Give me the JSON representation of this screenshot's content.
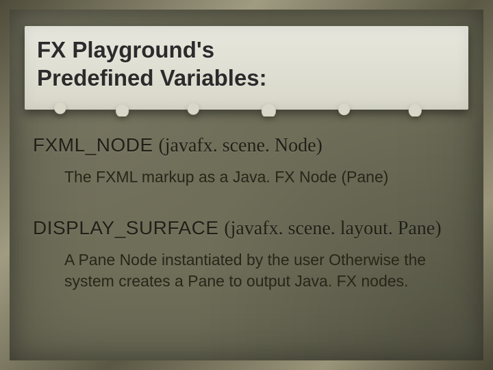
{
  "title_line1": "FX Playground's",
  "title_line2": "Predefined Variables:",
  "vars": [
    {
      "name": "FXML_NODE",
      "type": "(javafx. scene. Node)",
      "desc": "The FXML markup as a Java. FX Node (Pane)"
    },
    {
      "name": "DISPLAY_SURFACE",
      "type": "(javafx. scene. layout. Pane)",
      "desc": "A Pane Node instantiated by the user Otherwise the system creates a Pane to output Java. FX nodes."
    }
  ]
}
